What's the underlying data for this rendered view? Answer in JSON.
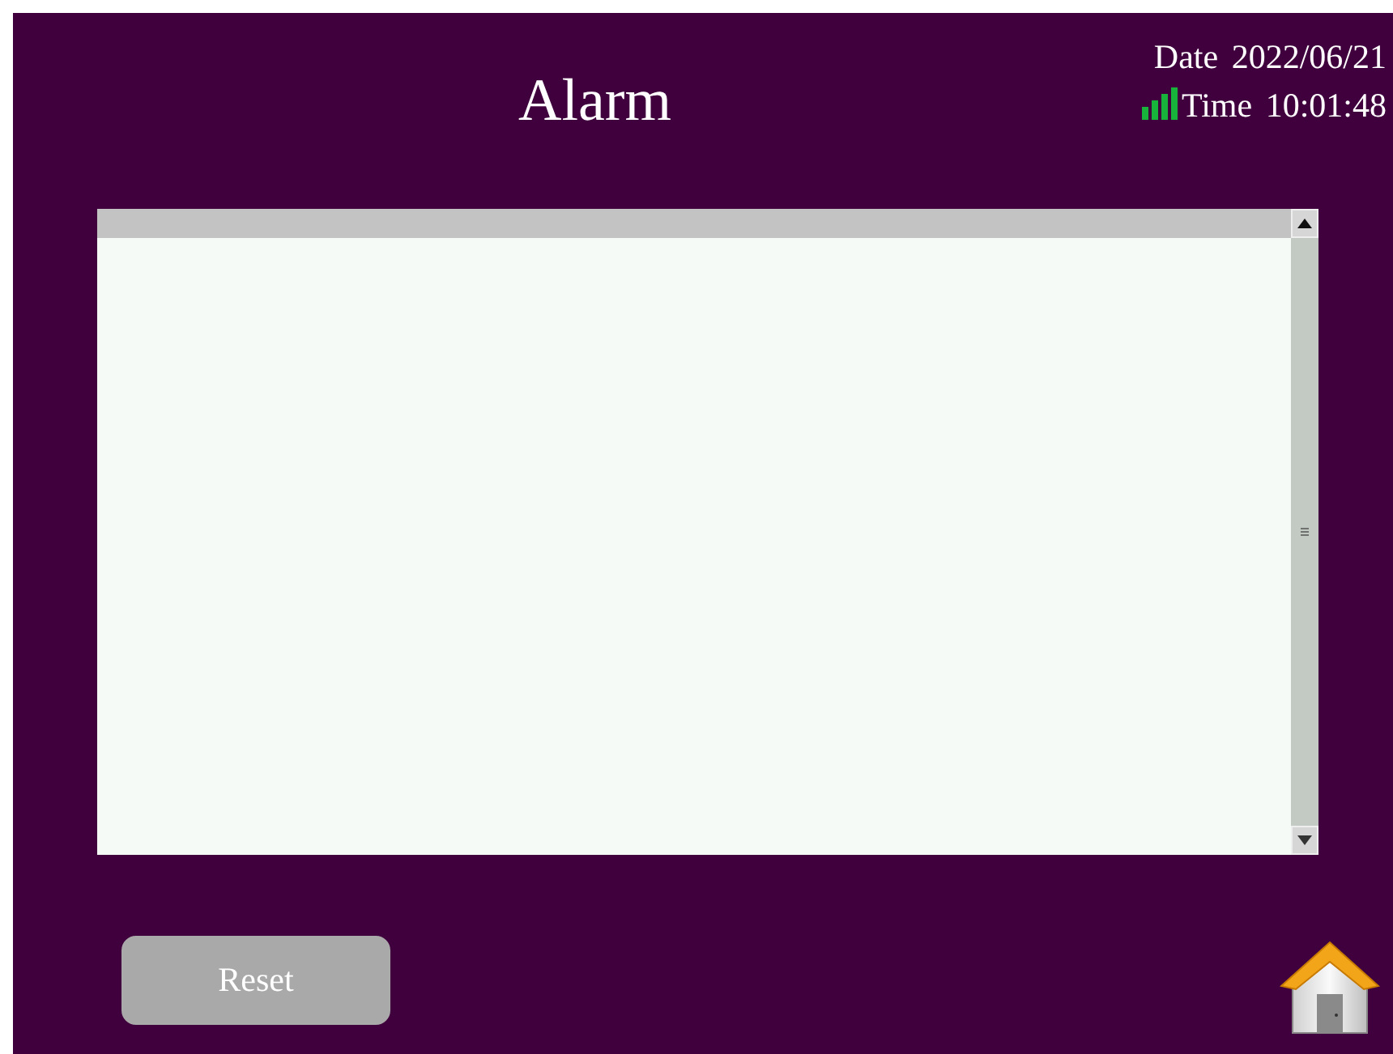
{
  "title": "Alarm",
  "date": {
    "label": "Date",
    "value": "2022/06/21"
  },
  "time": {
    "label": "Time",
    "value": "10:01:48"
  },
  "reset_button": {
    "label": "Reset",
    "disabled": true
  }
}
